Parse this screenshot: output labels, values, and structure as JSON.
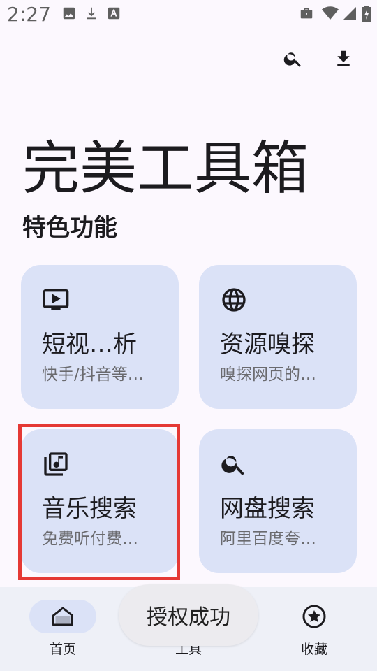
{
  "status_bar": {
    "time": "2:27",
    "left_icons": [
      "image-icon",
      "download-icon",
      "font-icon"
    ],
    "right_icons": [
      "briefcase-icon",
      "wifi-icon",
      "signal-icon",
      "battery-icon"
    ]
  },
  "top_bar": {
    "icons": [
      "search-icon",
      "download-icon"
    ]
  },
  "app": {
    "title": "完美工具箱",
    "section_title": "特色功能"
  },
  "cards": [
    {
      "title": "短视…析",
      "subtitle": "快手/抖音等…",
      "icon": "tv-icon"
    },
    {
      "title": "资源嗅探",
      "subtitle": "嗅探网页的…",
      "icon": "globe-icon"
    },
    {
      "title": "音乐搜索",
      "subtitle": "免费听付费…",
      "icon": "music-library-icon"
    },
    {
      "title": "网盘搜索",
      "subtitle": "阿里百度夸…",
      "icon": "search-icon"
    }
  ],
  "bottom_nav": [
    {
      "label": "首页",
      "icon": "home-icon",
      "selected": true
    },
    {
      "label": "工具",
      "icon": "tools-icon",
      "selected": false
    },
    {
      "label": "收藏",
      "icon": "star-icon",
      "selected": false
    }
  ],
  "toast": {
    "text": "授权成功"
  },
  "colors": {
    "background": "#fcf8fe",
    "card": "#dbe2f7",
    "nav_bar": "#eef0f7",
    "highlight": "#e53935"
  }
}
